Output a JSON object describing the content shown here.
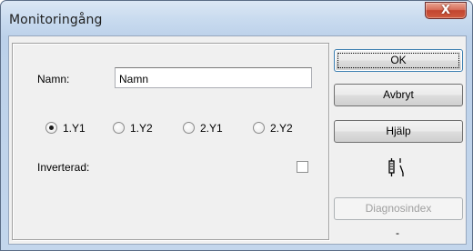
{
  "window": {
    "title": "Monitoringång",
    "close_glyph": "X"
  },
  "form": {
    "name_label": "Namn:",
    "name_value": "Namn",
    "radios": [
      {
        "label": "1.Y1",
        "checked": true
      },
      {
        "label": "1.Y2",
        "checked": false
      },
      {
        "label": "2.Y1",
        "checked": false
      },
      {
        "label": "2.Y2",
        "checked": false
      }
    ],
    "inverted_label": "Inverterad:",
    "inverted_checked": false
  },
  "buttons": {
    "ok": "OK",
    "cancel": "Avbryt",
    "help": "Hjälp",
    "diagnostics": "Diagnosindex"
  },
  "status": {
    "diag_value": "-"
  },
  "icons": {
    "close": "close-icon",
    "connector": "contact-switch-icon"
  }
}
